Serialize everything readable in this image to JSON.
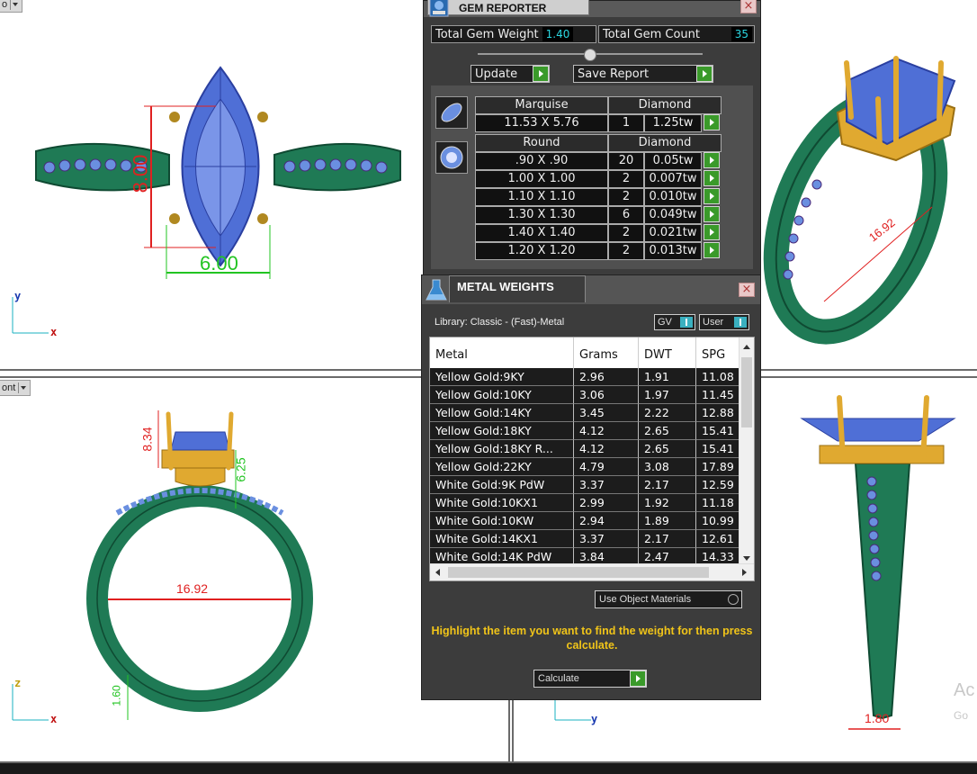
{
  "viewports": {
    "top_left": {
      "label": "o",
      "axis_a": "y",
      "axis_b": "x",
      "dim_h": "8.00",
      "dim_w": "6.00"
    },
    "top_right": {
      "dim": "16.92"
    },
    "bottom_left": {
      "label": "ont",
      "axis_a": "z",
      "axis_b": "x",
      "dim_a": "8.34",
      "dim_b": "6.25",
      "dim_ring": "16.92",
      "dim_c": "1.60"
    },
    "bottom_right": {
      "axis": "y",
      "dim": "1.80"
    }
  },
  "gem_reporter": {
    "title": "GEM REPORTER",
    "total_weight_label": "Total Gem Weight",
    "total_weight_value": "1.40",
    "total_count_label": "Total Gem Count",
    "total_count_value": "35",
    "update_label": "Update",
    "save_report_label": "Save Report",
    "groups": [
      {
        "shape": "Marquise",
        "material": "Diamond",
        "rows": [
          {
            "size": "11.53 X 5.76",
            "qty": "1",
            "tw": "1.25tw"
          }
        ]
      },
      {
        "shape": "Round",
        "material": "Diamond",
        "rows": [
          {
            "size": ".90 X .90",
            "qty": "20",
            "tw": "0.05tw"
          },
          {
            "size": "1.00 X 1.00",
            "qty": "2",
            "tw": "0.007tw"
          },
          {
            "size": "1.10 X 1.10",
            "qty": "2",
            "tw": "0.010tw"
          },
          {
            "size": "1.30 X 1.30",
            "qty": "6",
            "tw": "0.049tw"
          },
          {
            "size": "1.40 X 1.40",
            "qty": "2",
            "tw": "0.021tw"
          },
          {
            "size": "1.20 X 1.20",
            "qty": "2",
            "tw": "0.013tw"
          }
        ]
      }
    ]
  },
  "metal_weights": {
    "title": "METAL WEIGHTS",
    "library": "Library: Classic - (Fast)-Metal",
    "toggle_gv": "GV",
    "toggle_user": "User",
    "columns": [
      "Metal",
      "Grams",
      "DWT",
      "SPG"
    ],
    "rows": [
      [
        "Yellow Gold:9KY",
        "2.96",
        "1.91",
        "11.08"
      ],
      [
        "Yellow Gold:10KY",
        "3.06",
        "1.97",
        "11.45"
      ],
      [
        "Yellow Gold:14KY",
        "3.45",
        "2.22",
        "12.88"
      ],
      [
        "Yellow Gold:18KY",
        "4.12",
        "2.65",
        "15.41"
      ],
      [
        "Yellow Gold:18KY R...",
        "4.12",
        "2.65",
        "15.41"
      ],
      [
        "Yellow Gold:22KY",
        "4.79",
        "3.08",
        "17.89"
      ],
      [
        "White Gold:9K PdW",
        "3.37",
        "2.17",
        "12.59"
      ],
      [
        "White Gold:10KX1",
        "2.99",
        "1.92",
        "11.18"
      ],
      [
        "White Gold:10KW",
        "2.94",
        "1.89",
        "10.99"
      ],
      [
        "White Gold:14KX1",
        "3.37",
        "2.17",
        "12.61"
      ],
      [
        "White Gold:14K PdW",
        "3.84",
        "2.47",
        "14.33"
      ]
    ],
    "use_object_materials": "Use Object Materials",
    "note": "Highlight the item you want to find the weight for then press calculate.",
    "calculate_label": "Calculate"
  },
  "watermark": {
    "line1": "Ac",
    "line2": "Go"
  },
  "colors": {
    "band_green": "#1f7a55",
    "gem_blue": "#4f6fd6",
    "prong_gold": "#e0a930",
    "dim_red": "#e02020",
    "dim_green": "#22c422",
    "accent_cyan": "#2bd6e0",
    "note_yellow": "#f0c419"
  }
}
